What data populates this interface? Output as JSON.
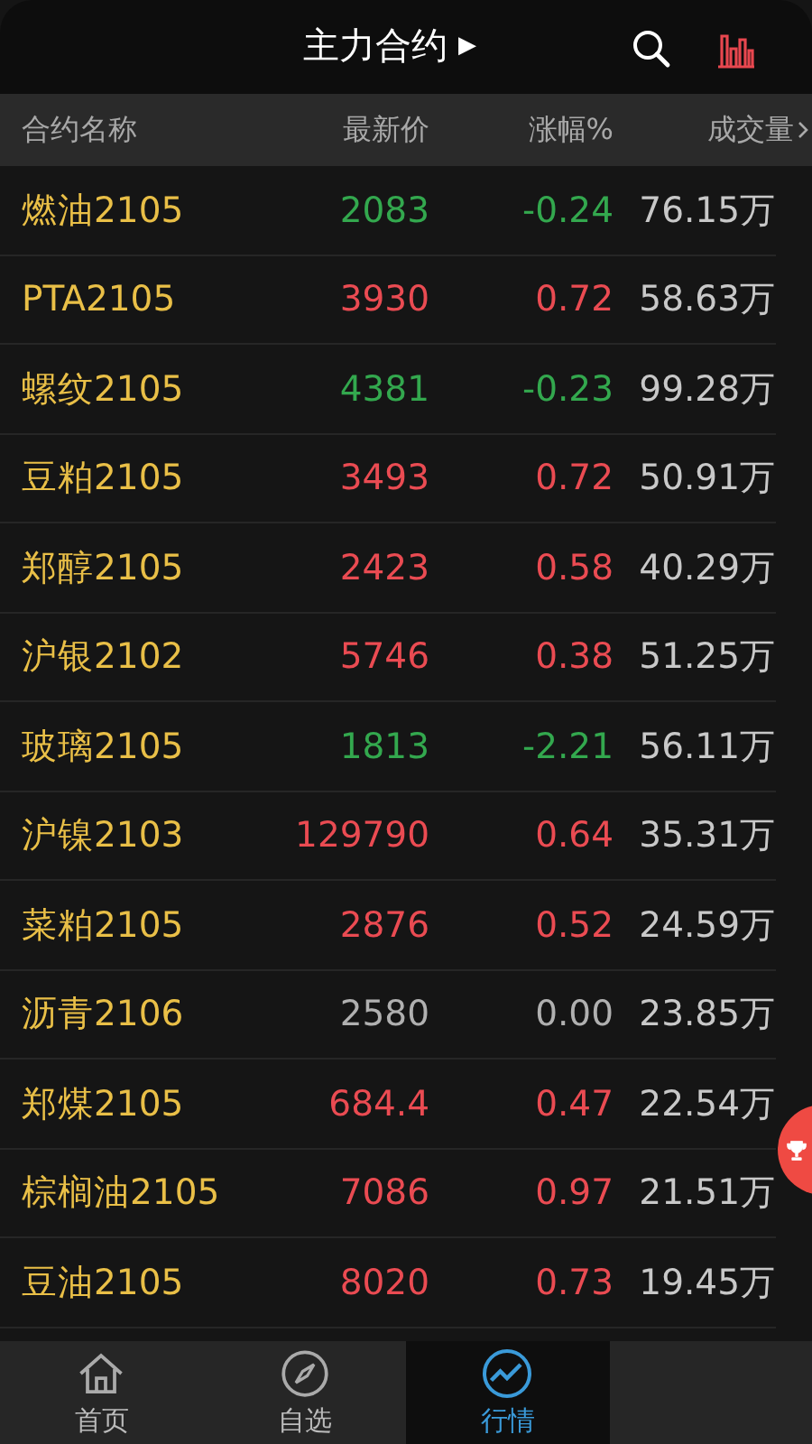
{
  "header": {
    "title": "主力合约",
    "title_arrow": "▶"
  },
  "table": {
    "columns": [
      "合约名称",
      "最新价",
      "涨幅%",
      "成交量"
    ],
    "rows": [
      {
        "name": "燃油2105",
        "price": "2083",
        "change": "-0.24",
        "volume": "76.15万",
        "color": "#33a84e"
      },
      {
        "name": "PTA2105",
        "price": "3930",
        "change": "0.72",
        "volume": "58.63万",
        "color": "#ea4b52"
      },
      {
        "name": "螺纹2105",
        "price": "4381",
        "change": "-0.23",
        "volume": "99.28万",
        "color": "#33a84e"
      },
      {
        "name": "豆粕2105",
        "price": "3493",
        "change": "0.72",
        "volume": "50.91万",
        "color": "#ea4b52"
      },
      {
        "name": "郑醇2105",
        "price": "2423",
        "change": "0.58",
        "volume": "40.29万",
        "color": "#ea4b52"
      },
      {
        "name": "沪银2102",
        "price": "5746",
        "change": "0.38",
        "volume": "51.25万",
        "color": "#ea4b52"
      },
      {
        "name": "玻璃2105",
        "price": "1813",
        "change": "-2.21",
        "volume": "56.11万",
        "color": "#33a84e"
      },
      {
        "name": "沪镍2103",
        "price": "129790",
        "change": "0.64",
        "volume": "35.31万",
        "color": "#ea4b52"
      },
      {
        "name": "菜粕2105",
        "price": "2876",
        "change": "0.52",
        "volume": "24.59万",
        "color": "#ea4b52"
      },
      {
        "name": "沥青2106",
        "price": "2580",
        "change": "0.00",
        "volume": "23.85万",
        "color": "#b0b0b0"
      },
      {
        "name": "郑煤2105",
        "price": "684.4",
        "change": "0.47",
        "volume": "22.54万",
        "color": "#ea4b52"
      },
      {
        "name": "棕榈油2105",
        "price": "7086",
        "change": "0.97",
        "volume": "21.51万",
        "color": "#ea4b52"
      },
      {
        "name": "豆油2105",
        "price": "8020",
        "change": "0.73",
        "volume": "19.45万",
        "color": "#ea4b52"
      }
    ]
  },
  "bottom_nav": [
    {
      "label": "首页",
      "selected": false
    },
    {
      "label": "自选",
      "selected": false
    },
    {
      "label": "行情",
      "selected": true
    }
  ]
}
